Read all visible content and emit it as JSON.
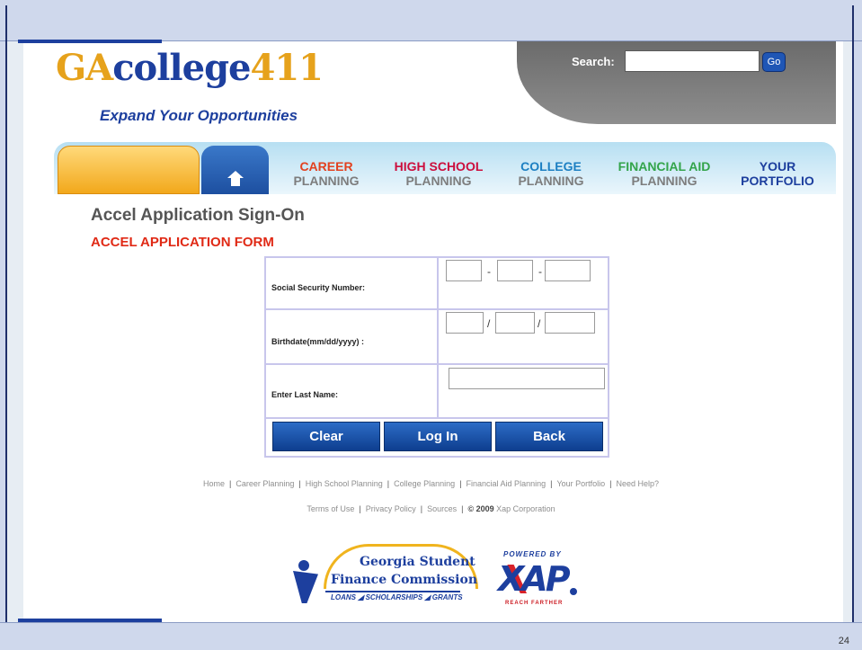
{
  "slide": {
    "number": "24"
  },
  "header": {
    "logo": {
      "ga": "GA",
      "college": "college",
      "num": "411"
    },
    "tagline": "Expand Your Opportunities",
    "search": {
      "label": "Search:",
      "placeholder": "",
      "button": "Go"
    }
  },
  "nav": {
    "tabs": [
      {
        "line1": "CAREER",
        "line2": "PLANNING"
      },
      {
        "line1": "HIGH SCHOOL",
        "line2": "PLANNING"
      },
      {
        "line1": "COLLEGE",
        "line2": "PLANNING"
      },
      {
        "line1": "FINANCIAL AID",
        "line2": "PLANNING"
      },
      {
        "line1": "YOUR",
        "line2": "PORTFOLIO"
      }
    ],
    "home_icon": "home-icon"
  },
  "main": {
    "page_title": "Accel Application Sign-On",
    "form_title": "ACCEL APPLICATION FORM",
    "form": {
      "ssn_label": "Social Security Number:",
      "ssn_sep": "-",
      "birthdate_label": "Birthdate(mm/dd/yyyy) :",
      "birthdate_sep": "/",
      "last_name_label": "Enter Last Name:",
      "buttons": {
        "clear": "Clear",
        "login": "Log In",
        "back": "Back"
      }
    }
  },
  "footer": {
    "links": [
      "Home",
      "Career Planning",
      "High School Planning",
      "College Planning",
      "Financial Aid Planning",
      "Your Portfolio",
      "Need Help?"
    ],
    "sep": "|",
    "legal": {
      "terms": "Terms of Use",
      "privacy": "Privacy Policy",
      "sources": "Sources",
      "copyright": "© 2009",
      "company": "Xap Corporation"
    }
  },
  "logos": {
    "gsfc": {
      "line1": "Georgia Student",
      "line2": "Finance Commission",
      "line3": "LOANS ◢ SCHOLARSHIPS ◢ GRANTS"
    },
    "xap": {
      "powered": "POWERED BY",
      "word": "XAP",
      "reach": "REACH FARTHER"
    }
  },
  "colors": {
    "brand_blue": "#1d3f9e",
    "brand_gold": "#e6a21c",
    "form_title_red": "#e02a16"
  }
}
